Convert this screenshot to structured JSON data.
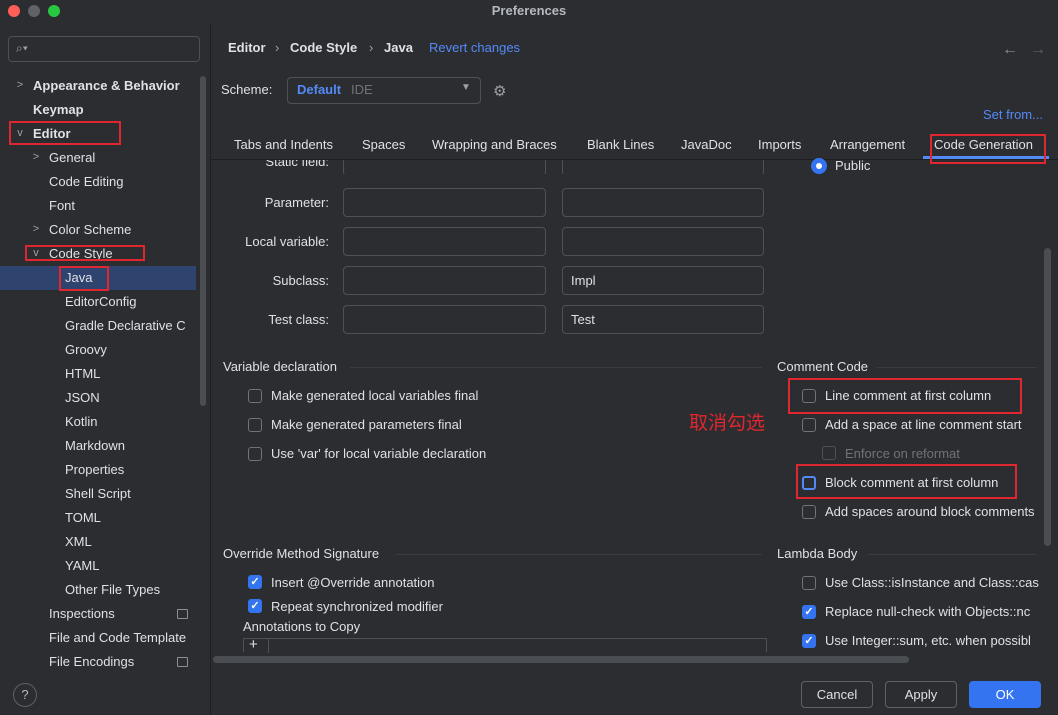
{
  "window": {
    "title": "Preferences"
  },
  "search": {
    "placeholder": ""
  },
  "sidebar": {
    "items": [
      {
        "label": "Appearance & Behavior"
      },
      {
        "label": "Keymap"
      },
      {
        "label": "Editor"
      },
      {
        "label": "General"
      },
      {
        "label": "Code Editing"
      },
      {
        "label": "Font"
      },
      {
        "label": "Color Scheme"
      },
      {
        "label": "Code Style"
      },
      {
        "label": "Java"
      },
      {
        "label": "EditorConfig"
      },
      {
        "label": "Gradle Declarative C"
      },
      {
        "label": "Groovy"
      },
      {
        "label": "HTML"
      },
      {
        "label": "JSON"
      },
      {
        "label": "Kotlin"
      },
      {
        "label": "Markdown"
      },
      {
        "label": "Properties"
      },
      {
        "label": "Shell Script"
      },
      {
        "label": "TOML"
      },
      {
        "label": "XML"
      },
      {
        "label": "YAML"
      },
      {
        "label": "Other File Types"
      },
      {
        "label": "Inspections"
      },
      {
        "label": "File and Code Template"
      },
      {
        "label": "File Encodings"
      }
    ],
    "help_label": "?"
  },
  "header": {
    "breadcrumb": [
      "Editor",
      "Code Style",
      "Java"
    ],
    "separator": "›",
    "revert_label": "Revert changes",
    "back_icon": "←",
    "forward_icon": "→"
  },
  "scheme": {
    "label": "Scheme:",
    "value": "Default",
    "type": "IDE",
    "set_from": "Set from..."
  },
  "tabs": [
    {
      "label": "Tabs and Indents"
    },
    {
      "label": "Spaces"
    },
    {
      "label": "Wrapping and Braces"
    },
    {
      "label": "Blank Lines"
    },
    {
      "label": "JavaDoc"
    },
    {
      "label": "Imports"
    },
    {
      "label": "Arrangement"
    },
    {
      "label": "Code Generation"
    }
  ],
  "naming": {
    "rows": [
      {
        "label": "Static field:",
        "prefix": "",
        "suffix": ""
      },
      {
        "label": "Parameter:",
        "prefix": "",
        "suffix": ""
      },
      {
        "label": "Local variable:",
        "prefix": "",
        "suffix": ""
      },
      {
        "label": "Subclass:",
        "prefix": "",
        "suffix": "Impl"
      },
      {
        "label": "Test class:",
        "prefix": "",
        "suffix": "Test"
      }
    ],
    "visibility_option": "Public"
  },
  "variable_declaration": {
    "title": "Variable declaration",
    "options": [
      {
        "label": "Make generated local variables final",
        "checked": false
      },
      {
        "label": "Make generated parameters final",
        "checked": false
      },
      {
        "label": "Use 'var' for local variable declaration",
        "checked": false
      }
    ]
  },
  "comment_code": {
    "title": "Comment Code",
    "options": [
      {
        "label": "Line comment at first column",
        "checked": false
      },
      {
        "label": "Add a space at line comment start",
        "checked": false
      },
      {
        "label": "Enforce on reformat",
        "checked": false,
        "disabled": true
      },
      {
        "label": "Block comment at first column",
        "checked": false
      },
      {
        "label": "Add spaces around block comments",
        "checked": false
      }
    ]
  },
  "annotation_text": "取消勾选",
  "override_method": {
    "title": "Override Method Signature",
    "options": [
      {
        "label": "Insert @Override annotation",
        "checked": true
      },
      {
        "label": "Repeat synchronized modifier",
        "checked": true
      }
    ],
    "annotations_label": "Annotations to Copy",
    "add_icon": "+"
  },
  "lambda_body": {
    "title": "Lambda Body",
    "options": [
      {
        "label": "Use Class::isInstance and Class::cas",
        "checked": false
      },
      {
        "label": "Replace null-check with Objects::nc",
        "checked": true
      },
      {
        "label": "Use Integer::sum, etc. when possibl",
        "checked": true
      }
    ]
  },
  "footer": {
    "cancel_label": "Cancel",
    "apply_label": "Apply",
    "ok_label": "OK"
  },
  "colors": {
    "accent": "#548af7",
    "annotation_red": "#e0262e",
    "selection": "#2e436e"
  }
}
